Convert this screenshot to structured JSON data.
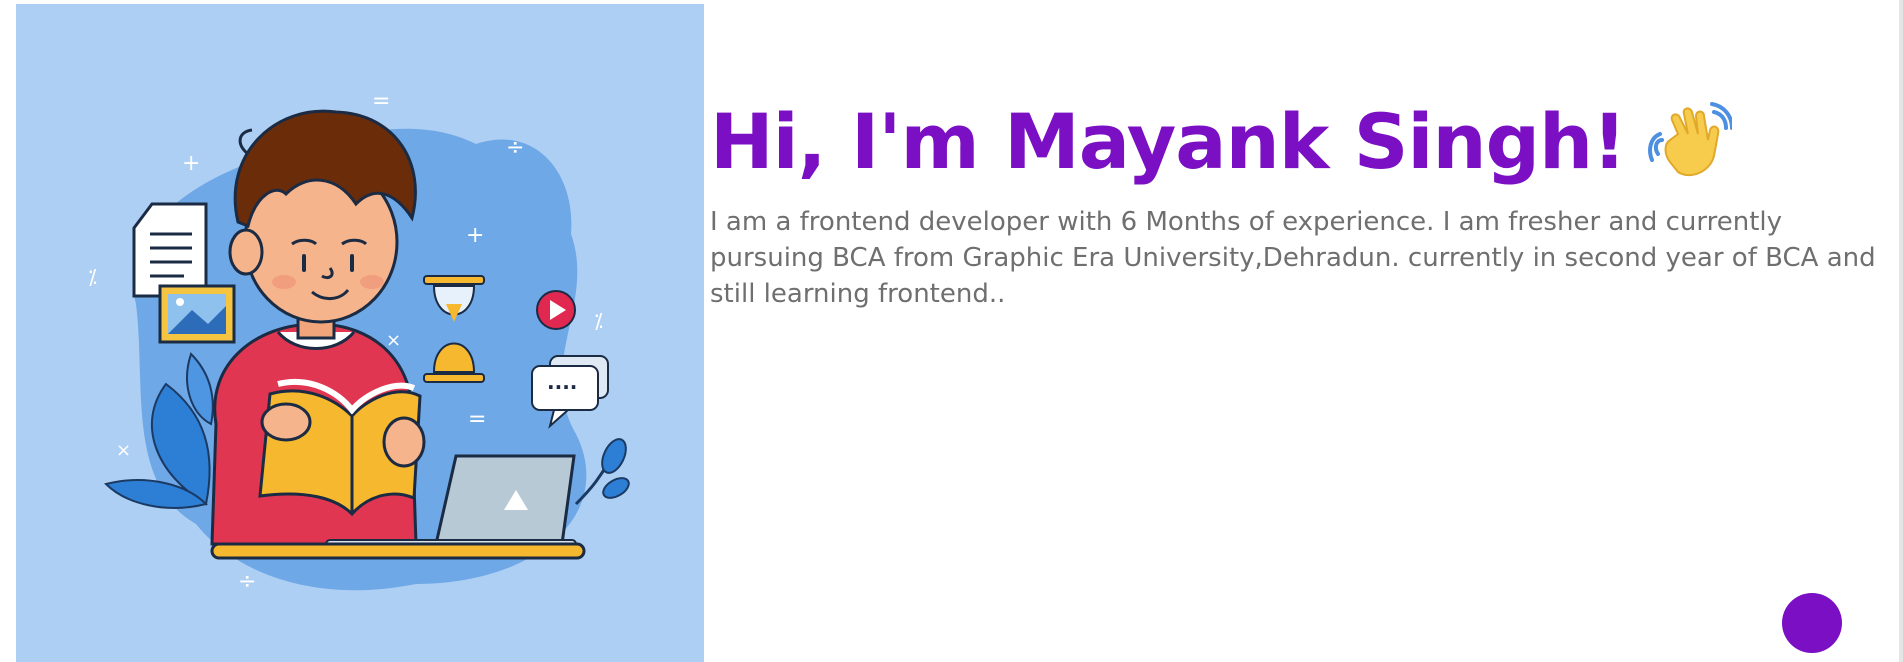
{
  "hero": {
    "title": "Hi, I'm Mayank Singh!",
    "wave_icon": "waving-hand-icon",
    "description": "I am a frontend developer with 6 Months of experience. I am fresher and currently pursuing BCA from Graphic Era University,Dehradun. currently in second year of BCA and still learning frontend.."
  },
  "illustration": {
    "subject": "student-reading-book-illustration",
    "message_bubble_text": "····"
  },
  "fab": {
    "icon": "circle-button-icon"
  },
  "colors": {
    "accent": "#7a0fc4",
    "body_text": "#6f6f6f",
    "illustration_bg": "#aecff4"
  }
}
